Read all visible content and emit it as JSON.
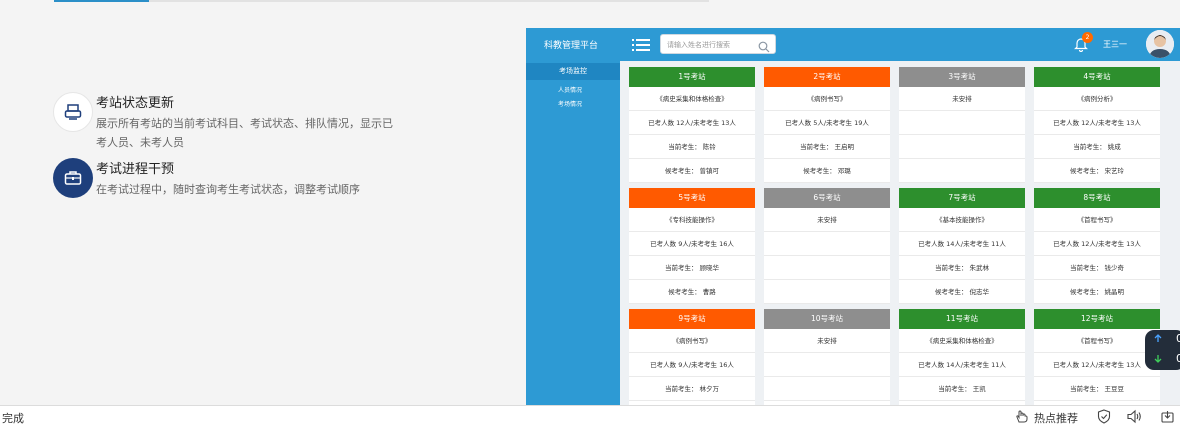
{
  "features": [
    {
      "icon": "printer-icon",
      "title": "考站状态更新",
      "desc": "展示所有考站的当前考试科目、考试状态、排队情况，显示已考人员、未考人员"
    },
    {
      "icon": "briefcase-icon",
      "title": "考试进程干预",
      "desc": "在考试过程中，随时查询考生考试状态，调整考试顺序"
    }
  ],
  "app": {
    "brand": "科教管理平台",
    "search_placeholder": "请输入姓名进行搜索",
    "notification_count": "2",
    "username": "王三一",
    "sidebar": {
      "active": "考场监控",
      "items": [
        "人员情况",
        "考场情况"
      ]
    }
  },
  "colors": {
    "in_progress": "#2d8f2d",
    "waiting": "#ff5a00",
    "unscheduled": "#8e8e8e",
    "header_blue": "#2d9ad4"
  },
  "stations": [
    {
      "name": "1号考站",
      "status": "in_progress",
      "subject": "《病史采集和体格检查》",
      "counts": "已考人数 12人/未考考生 13人",
      "current": "当前考生：  陈铃",
      "waiting": "候考考生：  曾镇可"
    },
    {
      "name": "2号考站",
      "status": "waiting",
      "subject": "《病例书写》",
      "counts": "已考人数 5人/未考考生 19人",
      "current": "当前考生：  王启明",
      "waiting": "候考考生：  邓璐"
    },
    {
      "name": "3号考站",
      "status": "unscheduled",
      "subject": "未安排",
      "counts": "",
      "current": "",
      "waiting": ""
    },
    {
      "name": "4号考站",
      "status": "in_progress",
      "subject": "《病例分析》",
      "counts": "已考人数 12人/未考考生 13人",
      "current": "当前考生：  姚成",
      "waiting": "候考考生：  宋艺玲"
    },
    {
      "name": "5号考站",
      "status": "waiting",
      "subject": "《专科技能操作》",
      "counts": "已考人数 9人/未考考生 16人",
      "current": "当前考生：  顾晓华",
      "waiting": "候考考生：  曹路"
    },
    {
      "name": "6号考站",
      "status": "unscheduled",
      "subject": "未安排",
      "counts": "",
      "current": "",
      "waiting": ""
    },
    {
      "name": "7号考站",
      "status": "in_progress",
      "subject": "《基本技能操作》",
      "counts": "已考人数 14人/未考考生 11人",
      "current": "当前考生：  朱武林",
      "waiting": "候考考生：  倪志华"
    },
    {
      "name": "8号考站",
      "status": "in_progress",
      "subject": "《首程书写》",
      "counts": "已考人数 12人/未考考生 13人",
      "current": "当前考生：  钱少奇",
      "waiting": "候考考生：  姚晶明"
    },
    {
      "name": "9号考站",
      "status": "waiting",
      "subject": "《病例书写》",
      "counts": "已考人数 9人/未考考生 16人",
      "current": "当前考生：  林夕万",
      "waiting": ""
    },
    {
      "name": "10号考站",
      "status": "unscheduled",
      "subject": "未安排",
      "counts": "",
      "current": "",
      "waiting": ""
    },
    {
      "name": "11号考站",
      "status": "in_progress",
      "subject": "《病史采集和体格检查》",
      "counts": "已考人数 14人/未考考生 11人",
      "current": "当前考生：  王凯",
      "waiting": ""
    },
    {
      "name": "12号考站",
      "status": "in_progress",
      "subject": "《首程书写》",
      "counts": "已考人数 12人/未考考生 13人",
      "current": "当前考生：  王豆豆",
      "waiting": ""
    }
  ],
  "scroll_widget": {
    "up_value": "0",
    "down_value": "0"
  },
  "statusbar": {
    "status": "完成",
    "hot_label": "热点推荐"
  }
}
